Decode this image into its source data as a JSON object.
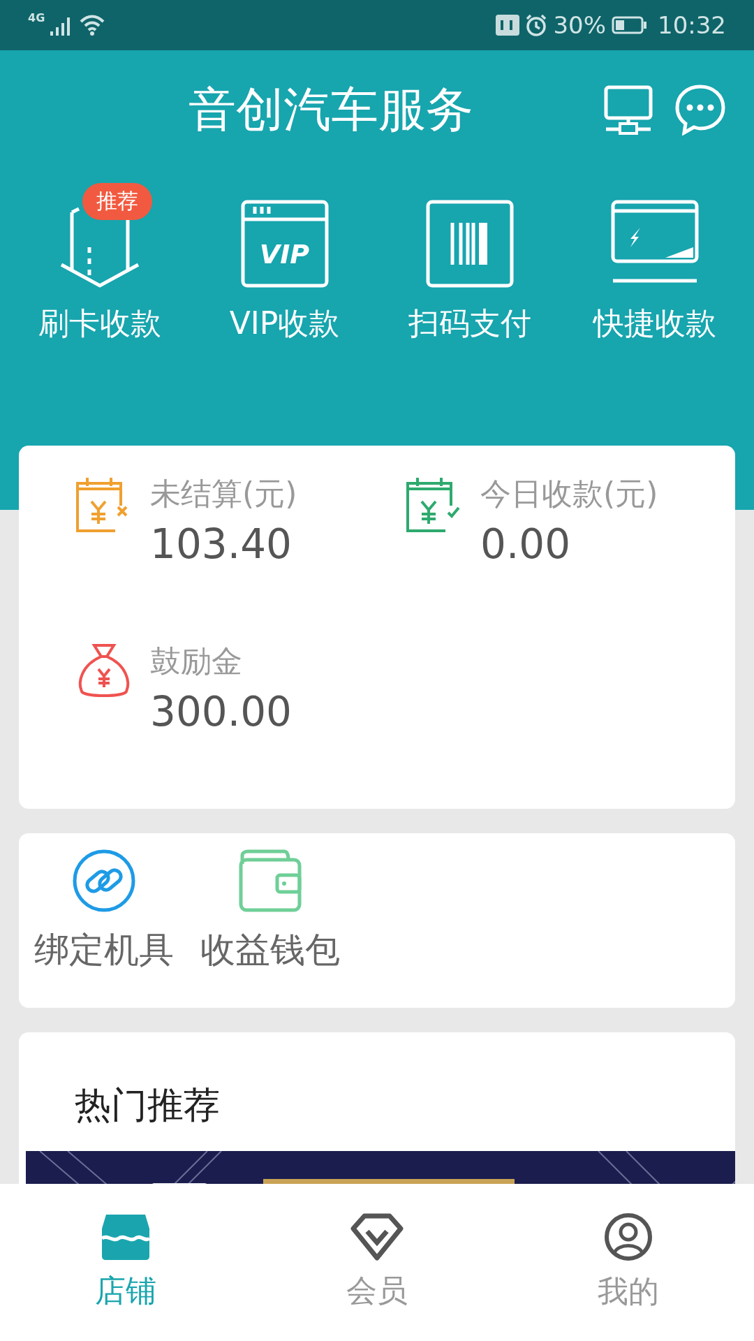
{
  "status_bar": {
    "network": "4G",
    "battery": "30%",
    "time": "10:32"
  },
  "header": {
    "title": "音创汽车服务"
  },
  "actions": [
    {
      "kind": "card",
      "label": "刷卡收款",
      "badge": "推荐"
    },
    {
      "kind": "vip",
      "label": "VIP收款",
      "icon_text": "VIP"
    },
    {
      "kind": "barcode",
      "label": "扫码支付"
    },
    {
      "kind": "quick",
      "label": "快捷收款"
    }
  ],
  "stats": [
    {
      "kind": "pending",
      "label": "未结算(元)",
      "value": "103.40",
      "color": "#f0a030"
    },
    {
      "kind": "today",
      "label": "今日收款(元)",
      "value": "0.00",
      "color": "#2eaa6e"
    },
    {
      "kind": "bonus",
      "label": "鼓励金",
      "value": "300.00",
      "color": "#ef5350"
    }
  ],
  "tools": [
    {
      "kind": "link",
      "label": "绑定机具",
      "color": "#1e9be6"
    },
    {
      "kind": "wallet",
      "label": "收益钱包",
      "color": "#6fcf97"
    }
  ],
  "recommend": {
    "title": "热门推荐"
  },
  "tabs": [
    {
      "kind": "shop",
      "label": "店铺",
      "selected": true
    },
    {
      "kind": "member",
      "label": "会员",
      "selected": false
    },
    {
      "kind": "me",
      "label": "我的",
      "selected": false
    }
  ]
}
